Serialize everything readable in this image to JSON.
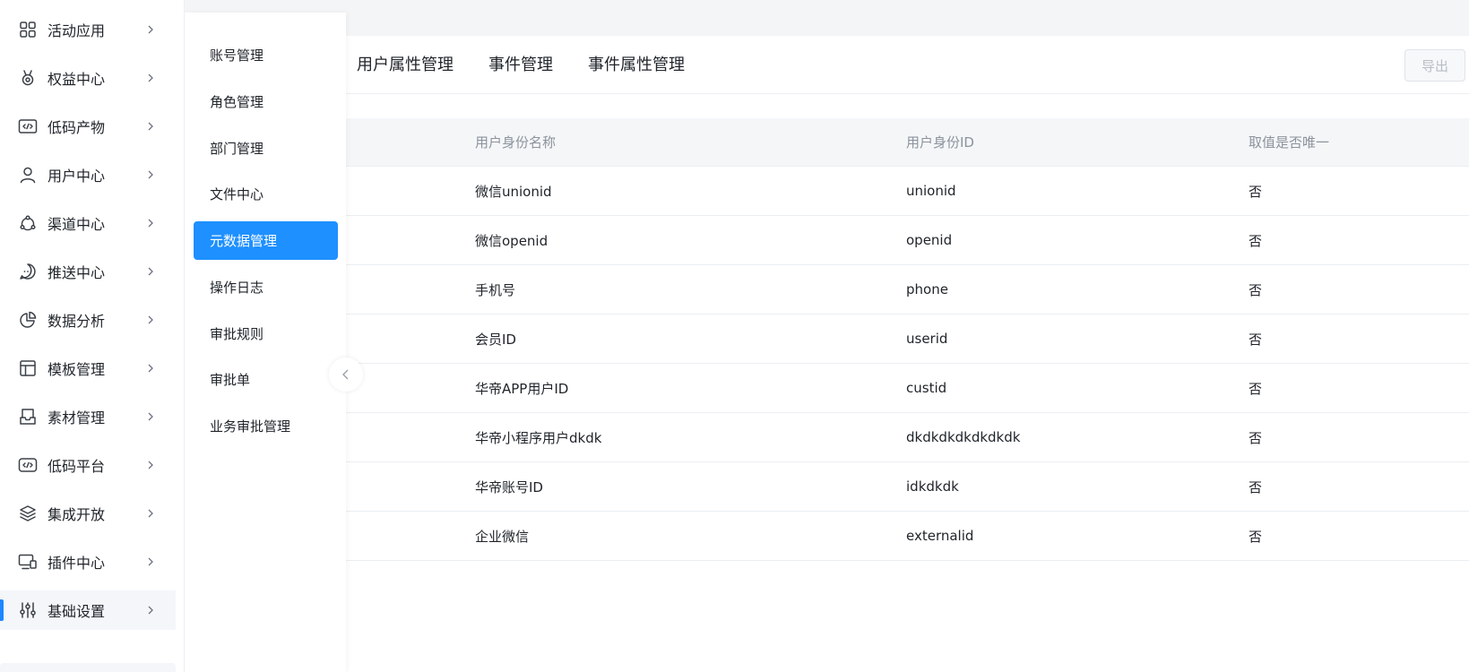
{
  "sidebar": {
    "items": [
      {
        "label": "活动应用",
        "icon": "grid-apps-icon"
      },
      {
        "label": "权益中心",
        "icon": "medal-icon"
      },
      {
        "label": "低码产物",
        "icon": "code-window-icon"
      },
      {
        "label": "用户中心",
        "icon": "user-icon"
      },
      {
        "label": "渠道中心",
        "icon": "channel-nodes-icon"
      },
      {
        "label": "推送中心",
        "icon": "chat-bubble-icon"
      },
      {
        "label": "数据分析",
        "icon": "pie-chart-icon"
      },
      {
        "label": "模板管理",
        "icon": "template-layout-icon"
      },
      {
        "label": "素材管理",
        "icon": "inbox-tray-icon"
      },
      {
        "label": "低码平台",
        "icon": "code-box-icon"
      },
      {
        "label": "集成开放",
        "icon": "layers-icon"
      },
      {
        "label": "插件中心",
        "icon": "monitor-plugin-icon"
      },
      {
        "label": "基础设置",
        "icon": "sliders-icon"
      }
    ],
    "active_index": 12
  },
  "submenu": {
    "items": [
      "账号管理",
      "角色管理",
      "部门管理",
      "文件中心",
      "元数据管理",
      "操作日志",
      "审批规则",
      "审批单",
      "业务审批管理"
    ],
    "active_index": 4
  },
  "tabs": [
    "用户属性管理",
    "事件管理",
    "事件属性管理"
  ],
  "toolbar": {
    "export_label": "导出"
  },
  "table": {
    "columns": [
      "用户身份名称",
      "用户身份ID",
      "取值是否唯一"
    ],
    "rows": [
      [
        "微信unionid",
        "unionid",
        "否"
      ],
      [
        "微信openid",
        "openid",
        "否"
      ],
      [
        "手机号",
        "phone",
        "否"
      ],
      [
        "会员ID",
        "userid",
        "否"
      ],
      [
        "华帝APP用户ID",
        "custid",
        "否"
      ],
      [
        "华帝小程序用户dkdk",
        "dkdkdkdkdkdkdk",
        "否"
      ],
      [
        "华帝账号ID",
        "idkdkdk",
        "否"
      ],
      [
        "企业微信",
        "externalid",
        "否"
      ]
    ]
  },
  "colors": {
    "accent": "#1e90ff",
    "active_bar": "#1e86ff",
    "text": "#1f2329",
    "muted": "#8c939d"
  }
}
